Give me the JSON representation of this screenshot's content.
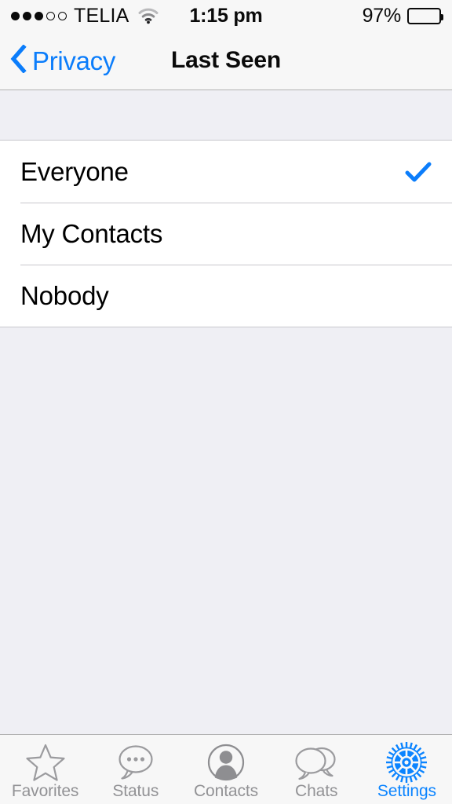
{
  "status_bar": {
    "signal_dots_filled": 3,
    "signal_dots_total": 5,
    "carrier": "TELIA",
    "wifi_icon": "wifi-icon",
    "time": "1:15 pm",
    "battery_percent": "97%",
    "battery_level": 97
  },
  "nav_bar": {
    "back_icon": "chevron-left-icon",
    "back_label": "Privacy",
    "title": "Last Seen"
  },
  "list": {
    "options": [
      {
        "label": "Everyone",
        "selected": true,
        "check_icon": "checkmark-icon"
      },
      {
        "label": "My Contacts",
        "selected": false,
        "check_icon": ""
      },
      {
        "label": "Nobody",
        "selected": false,
        "check_icon": ""
      }
    ]
  },
  "tab_bar": {
    "items": [
      {
        "label": "Favorites",
        "icon": "star-icon",
        "active": false
      },
      {
        "label": "Status",
        "icon": "speech-bubble-dots-icon",
        "active": false
      },
      {
        "label": "Contacts",
        "icon": "person-circle-icon",
        "active": false
      },
      {
        "label": "Chats",
        "icon": "double-speech-bubble-icon",
        "active": false
      },
      {
        "label": "Settings",
        "icon": "gear-icon",
        "active": true
      }
    ]
  },
  "colors": {
    "accent_blue": "#0b7dfb",
    "tab_active_blue": "#0b84ff",
    "tab_inactive_gray": "#929295",
    "group_background": "#efeff4",
    "separator": "#c8c7cc",
    "bar_background": "#f7f7f7"
  }
}
